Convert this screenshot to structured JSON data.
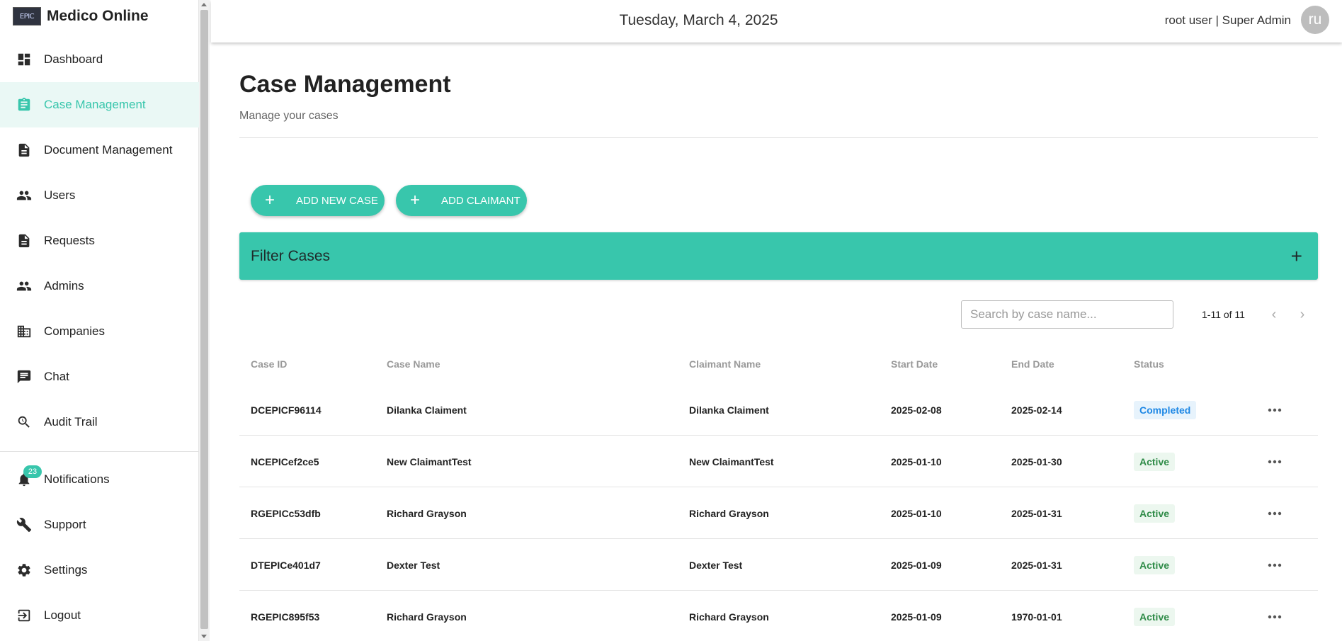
{
  "brand": {
    "logo_text": "EPIC",
    "name": "Medico Online"
  },
  "sidebar": {
    "items": [
      {
        "label": "Dashboard",
        "icon": "dashboard-icon",
        "active": false
      },
      {
        "label": "Case Management",
        "icon": "clipboard-icon",
        "active": true
      },
      {
        "label": "Document Management",
        "icon": "document-icon",
        "active": false
      },
      {
        "label": "Users",
        "icon": "people-icon",
        "active": false
      },
      {
        "label": "Requests",
        "icon": "document-icon",
        "active": false
      },
      {
        "label": "Admins",
        "icon": "people-icon",
        "active": false
      },
      {
        "label": "Companies",
        "icon": "building-icon",
        "active": false
      },
      {
        "label": "Chat",
        "icon": "chat-icon",
        "active": false
      },
      {
        "label": "Audit Trail",
        "icon": "search-history-icon",
        "active": false
      }
    ],
    "bottom_items": [
      {
        "label": "Notifications",
        "icon": "bell-icon",
        "badge": "23"
      },
      {
        "label": "Support",
        "icon": "wrench-icon"
      },
      {
        "label": "Settings",
        "icon": "gear-icon"
      },
      {
        "label": "Logout",
        "icon": "logout-icon"
      }
    ]
  },
  "header": {
    "date": "Tuesday, March 4, 2025",
    "user": "root user | Super Admin",
    "avatar_initials": "ru"
  },
  "page": {
    "title": "Case Management",
    "subtitle": "Manage your cases",
    "add_case_label": "ADD NEW CASE",
    "add_claimant_label": "ADD CLAIMANT",
    "filter_title": "Filter Cases",
    "search_placeholder": "Search by case name...",
    "pagination": "1-11 of 11"
  },
  "table": {
    "headers": [
      "Case ID",
      "Case Name",
      "Claimant Name",
      "Start Date",
      "End Date",
      "Status"
    ],
    "rows": [
      {
        "case_id": "DCEPICF96114",
        "case_name": "Dilanka Claiment",
        "claimant": "Dilanka Claiment",
        "start": "2025-02-08",
        "end": "2025-02-14",
        "status": "Completed"
      },
      {
        "case_id": "NCEPICef2ce5",
        "case_name": "New ClaimantTest",
        "claimant": "New ClaimantTest",
        "start": "2025-01-10",
        "end": "2025-01-30",
        "status": "Active"
      },
      {
        "case_id": "RGEPICc53dfb",
        "case_name": "Richard Grayson",
        "claimant": "Richard Grayson",
        "start": "2025-01-10",
        "end": "2025-01-31",
        "status": "Active"
      },
      {
        "case_id": "DTEPICe401d7",
        "case_name": "Dexter Test",
        "claimant": "Dexter Test",
        "start": "2025-01-09",
        "end": "2025-01-31",
        "status": "Active"
      },
      {
        "case_id": "RGEPIC895f53",
        "case_name": "Richard Grayson",
        "claimant": "Richard Grayson",
        "start": "2025-01-09",
        "end": "1970-01-01",
        "status": "Active"
      }
    ]
  },
  "colors": {
    "accent": "#38c6ac",
    "accent_light": "#eaf8f5",
    "completed": "#1e88e5",
    "active": "#2e8b47"
  }
}
